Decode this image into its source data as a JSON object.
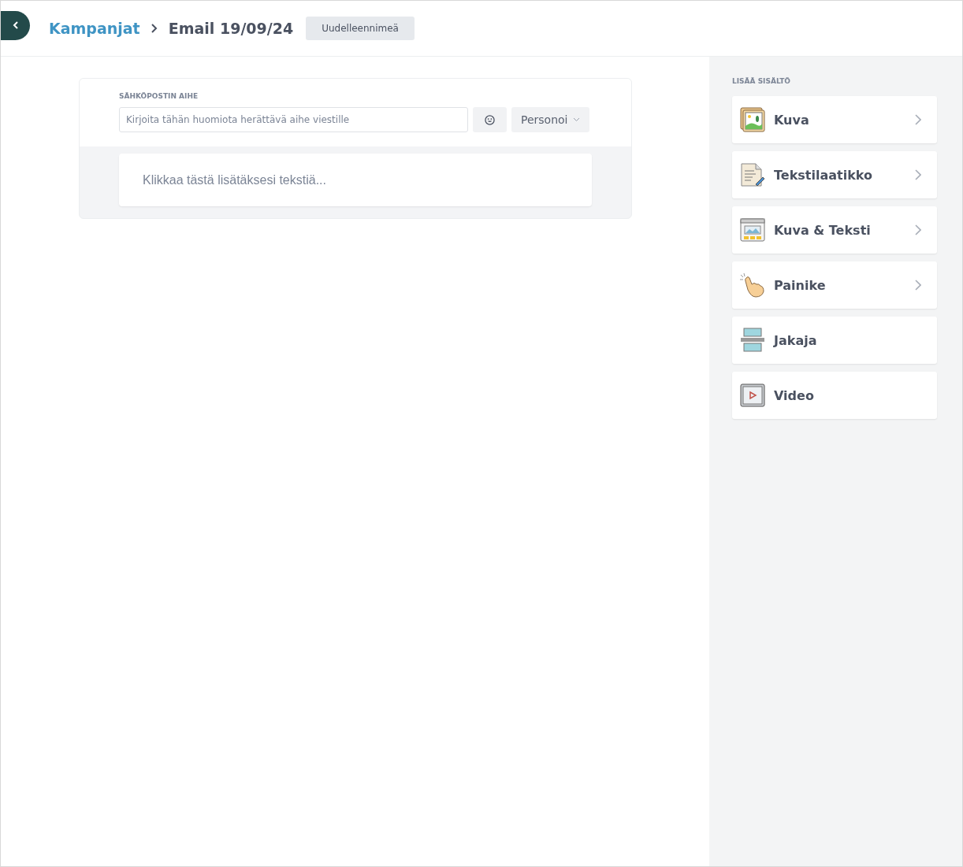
{
  "header": {
    "breadcrumb": "Kampanjat",
    "title": "Email 19/09/24",
    "rename_button": "Uudelleennimeä"
  },
  "editor": {
    "subject_label": "SÄHKÖPOSTIN AIHE",
    "subject_placeholder": "Kirjoita tähän huomiota herättävä aihe viestille",
    "personalize_button": "Personoi",
    "text_block_placeholder": "Klikkaa tästä lisätäksesi tekstiä..."
  },
  "sidebar": {
    "title": "LISÄÄ SISÄLTÖ",
    "items": [
      {
        "label": "Kuva",
        "kind": "image",
        "expandable": true
      },
      {
        "label": "Tekstilaatikko",
        "kind": "textbox",
        "expandable": true
      },
      {
        "label": "Kuva & Teksti",
        "kind": "image-text",
        "expandable": true
      },
      {
        "label": "Painike",
        "kind": "button",
        "expandable": true
      },
      {
        "label": "Jakaja",
        "kind": "divider",
        "expandable": false
      },
      {
        "label": "Video",
        "kind": "video",
        "expandable": false
      }
    ]
  }
}
